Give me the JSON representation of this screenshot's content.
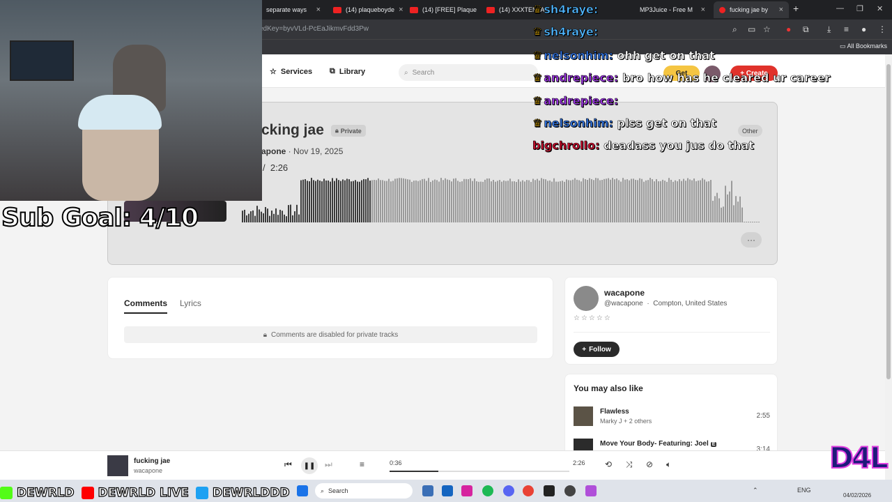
{
  "browser": {
    "tabs": [
      {
        "label": "separate ways",
        "active": false
      },
      {
        "label": "(14) plaqueboyde",
        "active": false
      },
      {
        "label": "(14) [FREE] Plaque",
        "active": false
      },
      {
        "label": "(14) XXXTENTA",
        "active": false
      },
      {
        "label": "MP3Juice - Free M",
        "active": false
      },
      {
        "label": "fucking jae by",
        "active": true
      }
    ],
    "url_fragment": "edKey=byvVLd-PcEaJikmvFdd3Pw",
    "bookmarks_label": "All Bookmarks"
  },
  "nav": {
    "services": "Services",
    "library": "Library",
    "search_placeholder": "Search",
    "get_label": "Get",
    "create_label": "+ Create"
  },
  "track": {
    "title_visible": "cking jae",
    "private_label": "Private",
    "artist": "apone",
    "date": " · Nov 19, 2025",
    "time_sep": "/",
    "duration": "2:26",
    "genre": "Other",
    "more": "···"
  },
  "comments": {
    "tab_comments": "Comments",
    "tab_lyrics": "Lyrics",
    "disabled_msg": "Comments are disabled for private tracks"
  },
  "artist_card": {
    "name": "wacapone",
    "handle": "@wacapone",
    "sep": "·",
    "location": "Compton, United States",
    "stars": "☆☆☆☆☆",
    "follow_label": "Follow"
  },
  "also_like": {
    "heading": "You may also like",
    "items": [
      {
        "title": "Flawless",
        "subtitle": "Marky J + 2 others",
        "duration": "2:55"
      },
      {
        "title": "Move Your Body- Featuring: Joel",
        "subtitle": "",
        "duration": "3:14",
        "explicit": "E"
      }
    ]
  },
  "player": {
    "title": "fucking jae",
    "artist": "wacapone",
    "current": "0:36",
    "duration": "2:26",
    "progress": 0.27
  },
  "taskbar": {
    "search_placeholder": "Search",
    "lang": "ENG",
    "date": "04/02/2026"
  },
  "overlay": {
    "sub_goal": "Sub Goal: 4/10",
    "chat": [
      {
        "name": "sh4raye:",
        "msg": "",
        "color": "#4fb6ff"
      },
      {
        "name": "nelsonhim:",
        "msg": "ohh get on that",
        "color": "#2f6fd8"
      },
      {
        "name": "andrepiece:",
        "msg": "bro how has he cleared ur career",
        "color": "#9b35e0"
      },
      {
        "name": "andrepiece:",
        "msg": "",
        "color": "#9b35e0"
      },
      {
        "name": "nelsonhim:",
        "msg": "plss get on that",
        "color": "#2f6fd8"
      },
      {
        "name": "bigchrollo:",
        "msg": "deadass you jus do that",
        "color": "#c8102e"
      }
    ],
    "socials": [
      "DEWRLD",
      "DEWRLD LIVE",
      "DEWRLDDD"
    ],
    "logo": "D4L"
  },
  "waveform": {
    "played_fraction": 0.25
  }
}
